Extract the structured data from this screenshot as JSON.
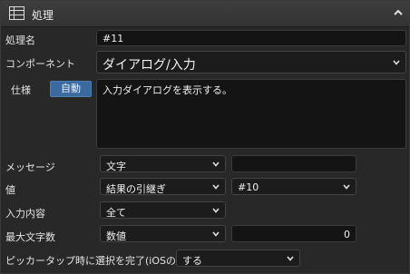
{
  "panel": {
    "title": "処理",
    "icon": "table-icon",
    "collapse_icon": "chevron-up-icon"
  },
  "fields": {
    "name_label": "処理名",
    "name_value": "#11",
    "component_label": "コンポーネント",
    "component_value": "ダイアログ/入力",
    "spec_label": "仕様",
    "spec_auto_button": "自動",
    "spec_value": "入力ダイアログを表示する。",
    "message_label": "メッセージ",
    "message_type": "文字",
    "message_value": "",
    "value_label": "値",
    "value_type": "結果の引継ぎ",
    "value_source": "#10",
    "input_content_label": "入力内容",
    "input_content_value": "全て",
    "max_chars_label": "最大文字数",
    "max_chars_type": "数値",
    "max_chars_value": "0",
    "picker_label": "ピッカータップ時に選択を完了(iOSのみ)",
    "picker_value": "する"
  },
  "colors": {
    "panel_bg": "#282828",
    "field_bg": "#141414",
    "accent_button": "#3b6aa0"
  }
}
